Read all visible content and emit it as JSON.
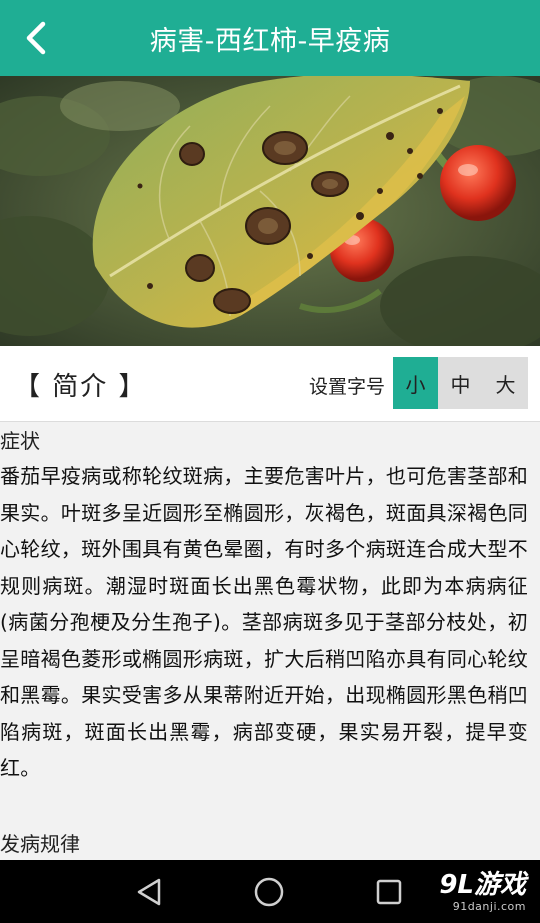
{
  "header": {
    "title": "病害-西红柿-早疫病",
    "back_icon": "chevron-left-icon",
    "color": "#1fae94"
  },
  "toolbar": {
    "section_title": "【 简介 】",
    "font_size_label": "设置字号",
    "font_sizes": [
      "小",
      "中",
      "大"
    ],
    "selected_font_size": "小"
  },
  "content": {
    "symptoms_heading": "症状",
    "symptoms_text": "番茄早疫病或称轮纹斑病，主要危害叶片，也可危害茎部和果实。叶斑多呈近圆形至椭圆形，灰褐色，斑面具深褐色同心轮纹，斑外围具有黄色晕圈，有时多个病斑连合成大型不规则病斑。潮湿时斑面长出黑色霉状物，此即为本病病征(病菌分孢梗及分生孢子)。茎部病斑多见于茎部分枝处，初呈暗褐色菱形或椭圆形病斑，扩大后稍凹陷亦具有同心轮纹和黑霉。果实受害多从果蒂附近开始，出现椭圆形黑色稍凹陷病斑，斑面长出黑霉，病部变硬，果实易开裂，提早变红。",
    "pattern_heading": "发病规律"
  },
  "navbar": {
    "back_icon": "triangle-back-icon",
    "home_icon": "circle-home-icon",
    "recents_icon": "square-recents-icon"
  },
  "watermark": {
    "main": "9L游戏",
    "sub": "91danji.com"
  }
}
